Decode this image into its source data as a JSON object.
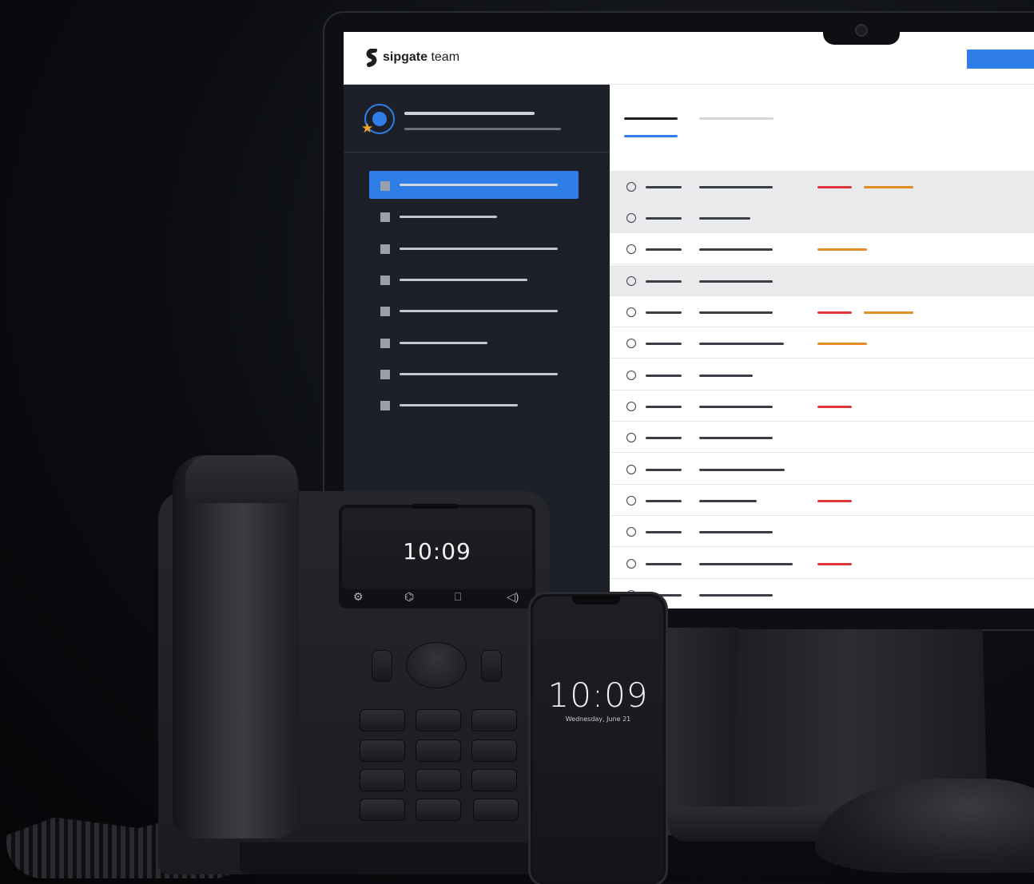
{
  "brand": {
    "name_bold": "sipgate",
    "name_light": " team",
    "accent_color": "#2f7ee8",
    "star_color": "#f3a523"
  },
  "icons": {
    "logo": "sipgate-logo-icon",
    "favorite": "star-icon",
    "softkeys": [
      "settings-icon",
      "voicemail-icon",
      "phonebook-icon",
      "speaker-icon"
    ]
  },
  "desk_phone": {
    "time": "10:09",
    "softkeys": [
      "⚙",
      "⌬",
      "⎕",
      "◁)"
    ]
  },
  "mobile": {
    "time": "10:09",
    "date": "Wednesday, June 21"
  },
  "status_colors": {
    "red": "#e2353b",
    "orange": "#e88d25"
  }
}
